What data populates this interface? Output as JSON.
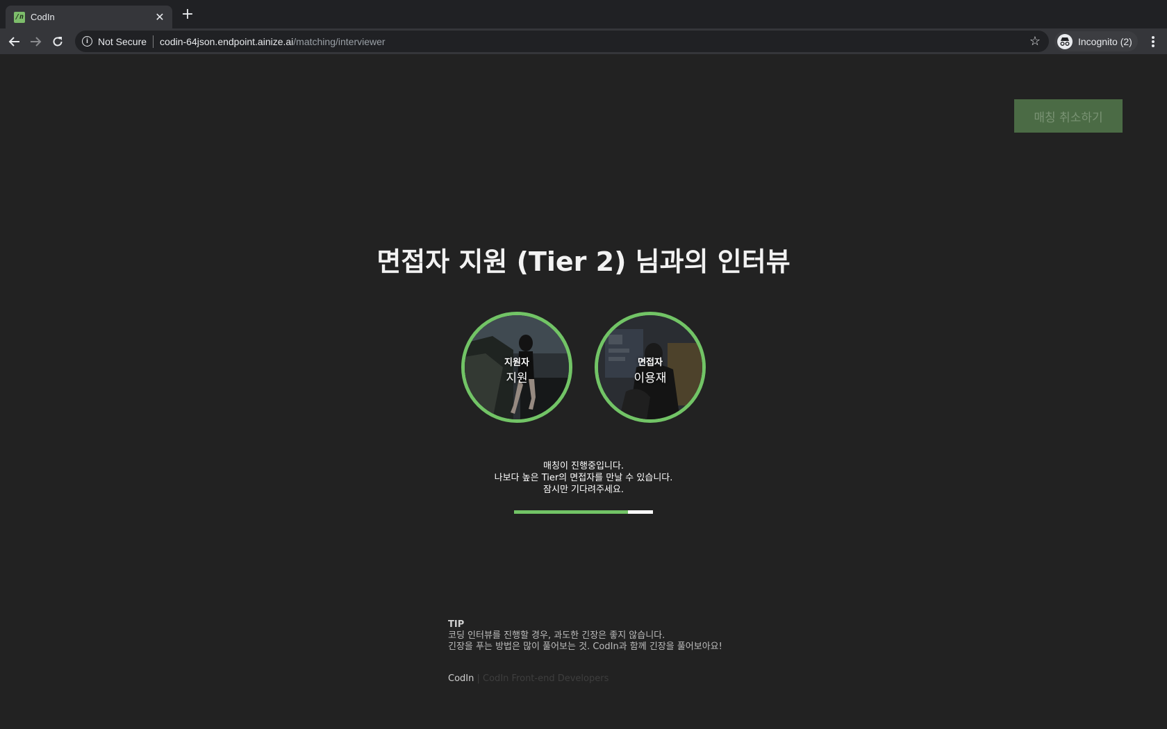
{
  "browser": {
    "tab_title": "CodIn",
    "favicon_text": "/n",
    "security_label": "Not Secure",
    "url_host": "codin-64json.endpoint.ainize.ai",
    "url_path": "/matching/interviewer",
    "profile_label": "Incognito (2)"
  },
  "page": {
    "cancel_button": "매칭 취소하기",
    "headline": "면접자 지원 (Tier 2) 님과의 인터뷰",
    "participants": [
      {
        "role": "지원자",
        "name": "지원"
      },
      {
        "role": "면접자",
        "name": "이용재"
      }
    ],
    "status_lines": [
      "매칭이 진행중입니다.",
      "나보다 높은 Tier의 면접자를 만날 수 있습니다.",
      "잠시만 기다려주세요."
    ],
    "progress_percent": 82,
    "tip": {
      "title": "TIP",
      "lines": [
        "코딩 인터뷰를 진행할 경우, 과도한 긴장은 좋지 않습니다.",
        "긴장을 푸는 방법은 많이 풀어보는 것. CodIn과 함께 긴장을 풀어보아요!"
      ]
    },
    "footer": {
      "brand": "CodIn",
      "separator": "|",
      "credit": "CodIn Front-end Developers"
    }
  },
  "colors": {
    "accent_green": "#72c466",
    "cancel_button_bg": "#4b6b45",
    "page_bg": "#222222"
  }
}
